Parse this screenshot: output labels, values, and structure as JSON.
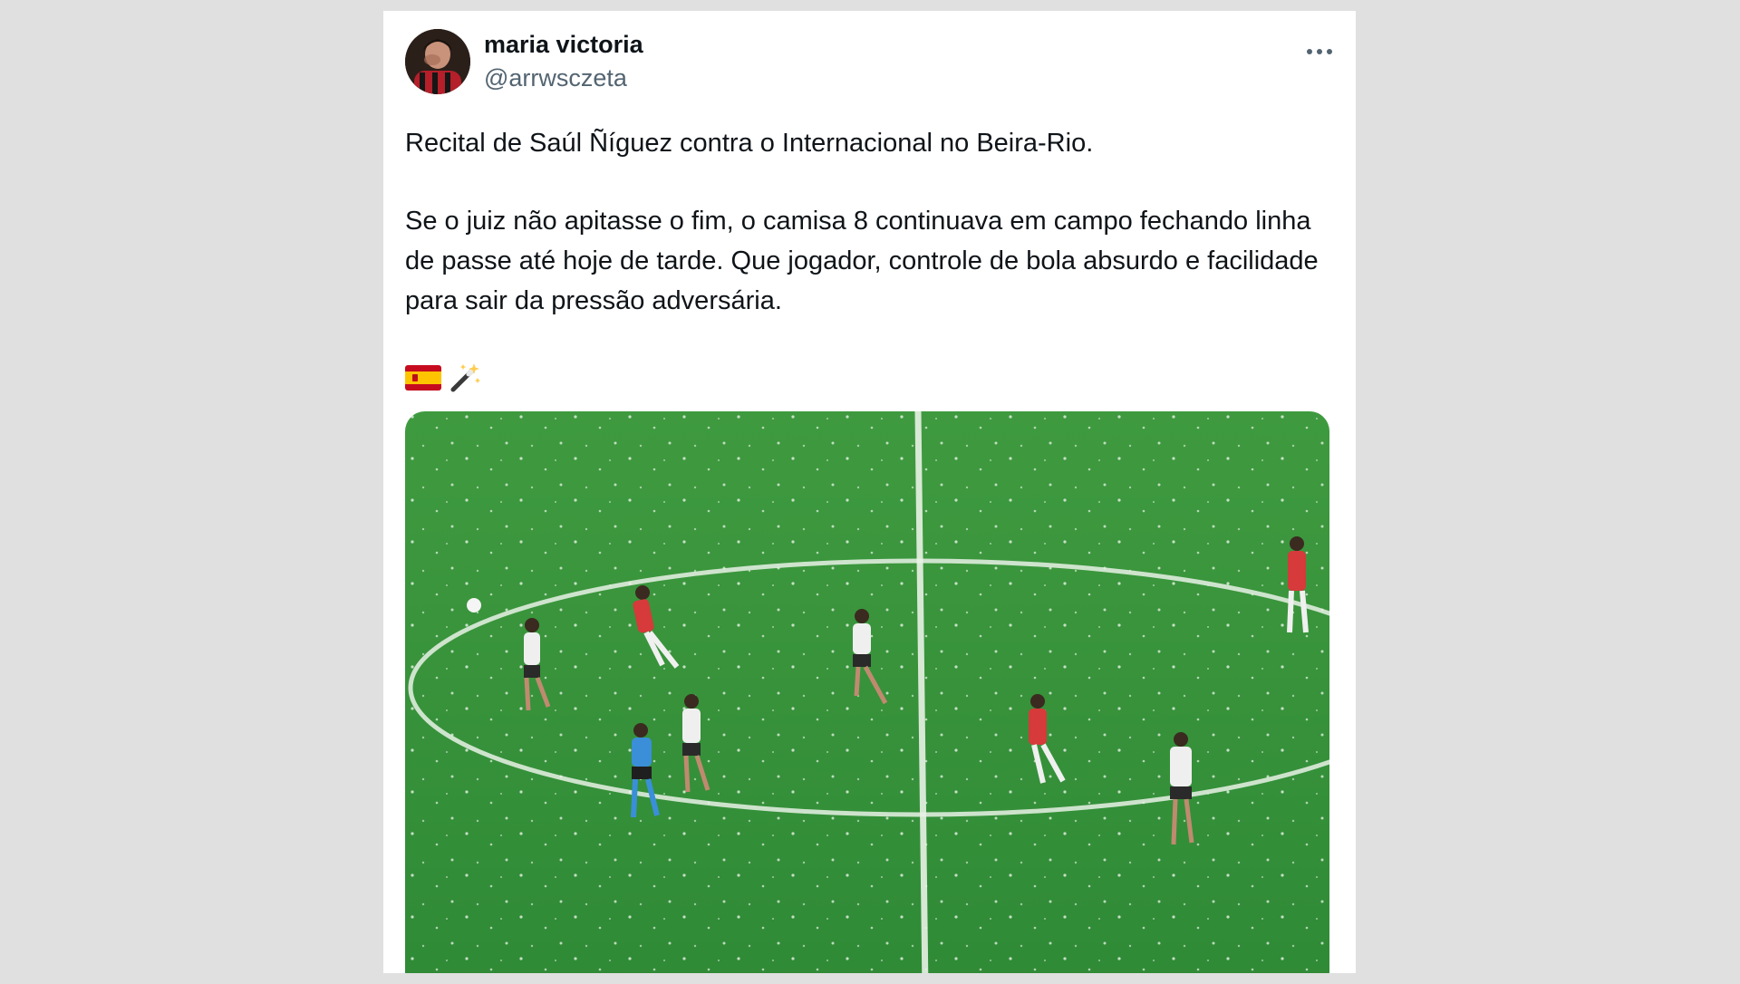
{
  "author": {
    "name": "maria victoria",
    "handle": "@arrwsczeta"
  },
  "tweet": {
    "paragraphs": [
      "Recital de Saúl Ñíguez contra o Internacional no Beira-Rio.",
      "Se o juiz não apitasse o fim, o camisa 8 continuava em campo fechando linha de passe até hoje de tarde. Que jogador, controle de bola absurdo e facilidade para sair da pressão adversária."
    ],
    "emojis": [
      "spain-flag-icon",
      "magic-wand-icon"
    ]
  },
  "media": {
    "type": "video-frame",
    "subject": "football match center circle",
    "colors": {
      "pitch": "#3b9a3b",
      "home_kit": "#d63a3a",
      "away_kit": "#f0f0f0",
      "referee_kit": "#3a8fd8"
    }
  },
  "icons": {
    "more": "more-horizontal-icon"
  },
  "colors": {
    "background": "#e0e0e0",
    "card": "#ffffff",
    "text": "#0f1419",
    "secondary_text": "#536471"
  }
}
